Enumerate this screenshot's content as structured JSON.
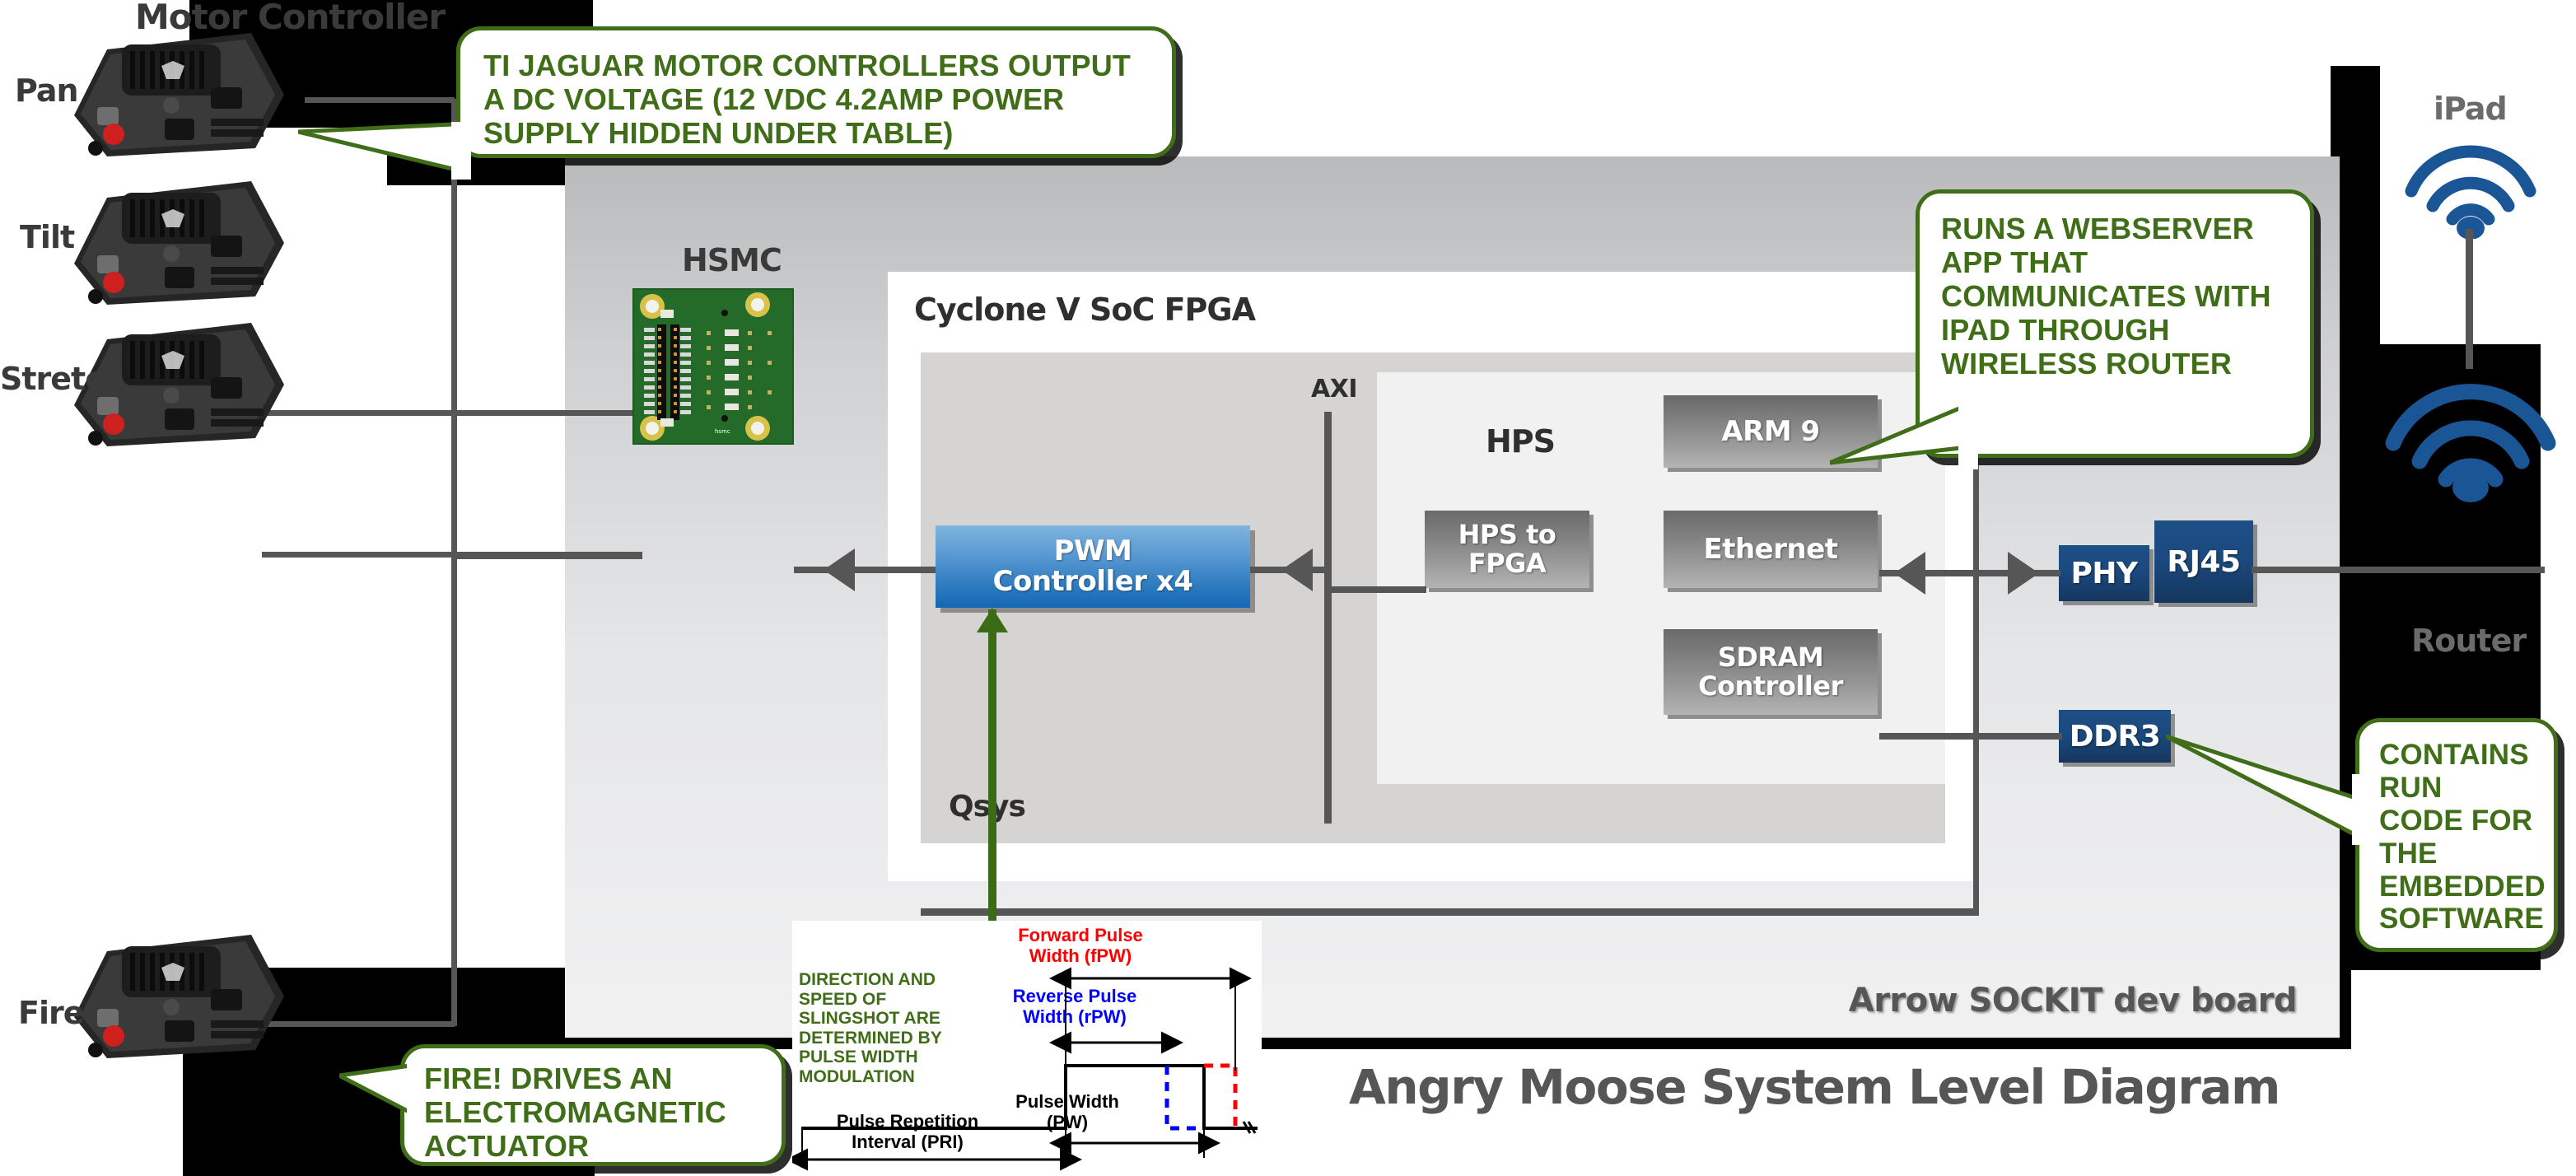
{
  "title": "Angry Moose System Level Diagram",
  "board": {
    "label": "Arrow SOCKIT dev board"
  },
  "fpga": {
    "title": "Cyclone V SoC FPGA",
    "qsys_label": "Qsys",
    "hps_label": "HPS",
    "axi_label": "AXI",
    "blocks": {
      "pwm_line1": "PWM",
      "pwm_line2": "Controller x4",
      "arm9": "ARM 9",
      "hps_to_fpga": "HPS to FPGA",
      "ethernet": "Ethernet",
      "sdram": "SDRAM Controller"
    }
  },
  "io_blocks": {
    "phy": "PHY",
    "rj45": "RJ45",
    "ddr3": "DDR3"
  },
  "hsmc": {
    "label": "HSMC"
  },
  "motors": {
    "header": "Motor Controller",
    "items": [
      {
        "label": "Pan"
      },
      {
        "label": "Tilt"
      },
      {
        "label": "Stretch"
      },
      {
        "label": "Fire!"
      }
    ]
  },
  "network": {
    "ipad_label": "iPad",
    "router_label": "Router"
  },
  "callouts": {
    "jaguar": "TI JAGUAR MOTOR CONTROLLERS OUTPUT A DC VOLTAGE (12 VDC 4.2AMP POWER SUPPLY HIDDEN UNDER TABLE)",
    "webserver": "RUNS A WEBSERVER APP THAT COMMUNICATES WITH IPAD THROUGH WIRELESS ROUTER",
    "ddr3": "CONTAINS RUN CODE FOR THE EMBEDDED SOFTWARE",
    "fire": "FIRE! DRIVES AN ELECTROMAGNETIC ACTUATOR",
    "pwm": "DIRECTION AND SPEED OF SLINGSHOT ARE DETERMINED BY PULSE WIDTH MODULATION"
  },
  "waveform": {
    "forward_pulse_width": "Forward Pulse Width (fPW)",
    "reverse_pulse_width": "Reverse Pulse Width (rPW)",
    "pulse_width": "Pulse Width (PW)",
    "pulse_repetition_interval": "Pulse Repetition Interval (PRI)"
  },
  "colors": {
    "green_accent": "#3f6d18",
    "blue_block": "#1268b4",
    "dark_blue": "#1d4e85",
    "wifi_blue": "#1a5595",
    "grey_wire": "#565656",
    "forward_red": "#ff0000",
    "reverse_blue": "#0000ff"
  }
}
